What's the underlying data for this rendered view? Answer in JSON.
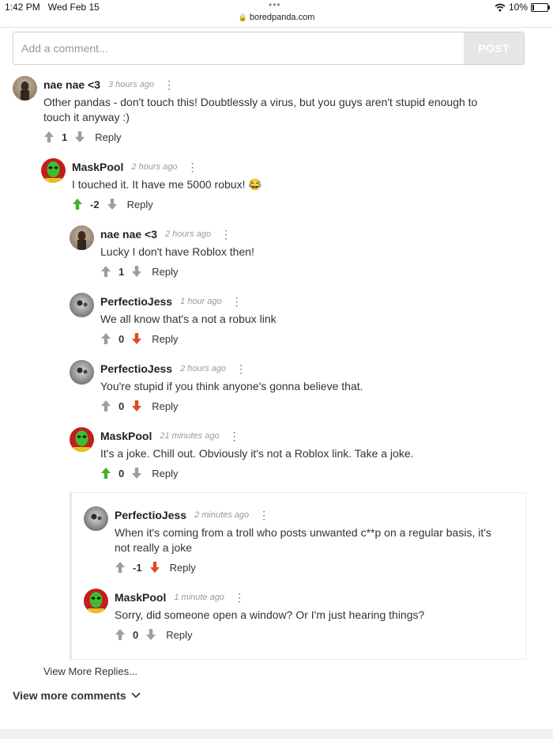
{
  "status_bar": {
    "time": "1:42 PM",
    "date": "Wed Feb 15",
    "url": "boredpanda.com",
    "battery": "10%",
    "battery_level": 0.1,
    "icons": [
      "wifi-icon",
      "battery-icon",
      "lock-icon"
    ]
  },
  "comment_form": {
    "placeholder": "Add a comment...",
    "post_label": "POST"
  },
  "comments": [
    {
      "author": "nae nae <3",
      "time": "3 hours ago",
      "text": "Other pandas - don't touch this! Doubtlessly a virus, but you guys aren't stupid enough to touch it anyway :)",
      "score": "1",
      "vote": "none",
      "reply": "Reply"
    },
    {
      "author": "MaskPool",
      "time": "2 hours ago",
      "text": "I touched it. It have me 5000 robux! 😂",
      "score": "-2",
      "vote": "up",
      "reply": "Reply"
    },
    {
      "author": "nae nae <3",
      "time": "2 hours ago",
      "text": "Lucky I don't have Roblox then!",
      "score": "1",
      "vote": "none",
      "reply": "Reply"
    },
    {
      "author": "PerfectioJess",
      "time": "1 hour ago",
      "text": "We all know that's a not a robux link",
      "score": "0",
      "vote": "down",
      "reply": "Reply"
    },
    {
      "author": "PerfectioJess",
      "time": "2 hours ago",
      "text": "You're stupid if you think anyone's gonna believe that.",
      "score": "0",
      "vote": "down",
      "reply": "Reply"
    },
    {
      "author": "MaskPool",
      "time": "21 minutes ago",
      "text": "It's a joke. Chill out. Obviously it's not a Roblox link. Take a joke.",
      "score": "0",
      "vote": "up",
      "reply": "Reply"
    },
    {
      "author": "PerfectioJess",
      "time": "2 minutes ago",
      "text": "When it's coming from a troll who posts unwanted c**p on a regular basis, it's not really a joke",
      "score": "-1",
      "vote": "down",
      "reply": "Reply"
    },
    {
      "author": "MaskPool",
      "time": "1 minute ago",
      "text": "Sorry, did someone open a window? Or I'm just hearing things?",
      "score": "0",
      "vote": "none",
      "reply": "Reply"
    }
  ],
  "view_more_replies": "View More Replies...",
  "view_more_comments": "View more comments",
  "colors": {
    "upvote_active": "#43b02a",
    "downvote_active": "#e04a1f",
    "vote_inactive": "#9e9e9e"
  }
}
